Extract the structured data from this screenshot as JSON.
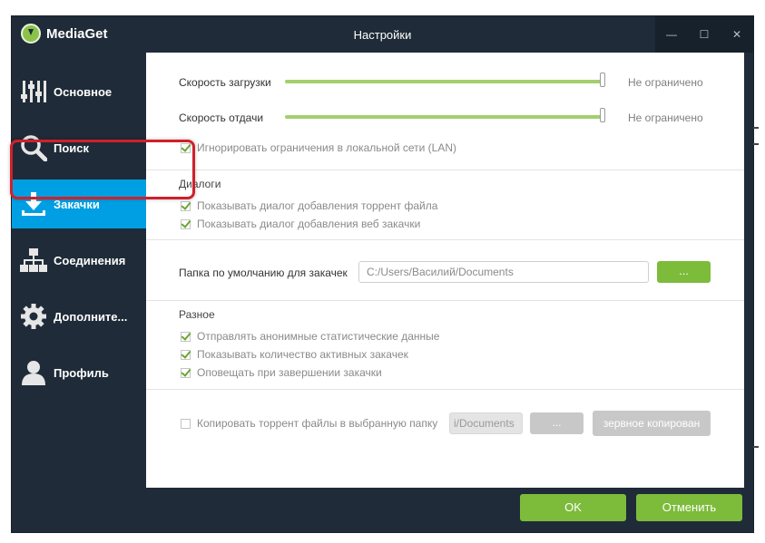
{
  "window": {
    "app_name": "MediaGet",
    "title": "Настройки",
    "controls": {
      "minimize": "—",
      "maximize": "☐",
      "close": "✕"
    }
  },
  "sidebar": {
    "items": [
      {
        "label": "Основное",
        "icon": "sliders-icon"
      },
      {
        "label": "Поиск",
        "icon": "search-icon"
      },
      {
        "label": "Закачки",
        "icon": "download-icon",
        "active": true
      },
      {
        "label": "Соединения",
        "icon": "network-icon"
      },
      {
        "label": "Дополните...",
        "icon": "gear-icon"
      },
      {
        "label": "Профиль",
        "icon": "user-icon"
      }
    ]
  },
  "speed": {
    "download_label": "Скорость загрузки",
    "download_value": "Не ограничено",
    "download_level": 1.0,
    "upload_label": "Скорость отдачи",
    "upload_value": "Не ограничено",
    "upload_level": 1.0,
    "ignore_lan": "Игнорировать ограничения в локальной сети (LAN)"
  },
  "dialogs": {
    "title": "Диалоги",
    "torrent": "Показывать диалог добавления торрент файла",
    "web": "Показывать диалог добавления веб закачки"
  },
  "folder": {
    "label": "Папка по умолчанию для закачек",
    "path": "C:/Users/Василий/Documents",
    "browse": "..."
  },
  "misc": {
    "title": "Разное",
    "stats": "Отправлять анонимные статистические данные",
    "count": "Показывать количество активных закачек",
    "notify": "Оповещать при завершении закачки"
  },
  "copy": {
    "label": "Копировать торрент файлы в выбранную папку",
    "path": "i/Documents",
    "browse": "...",
    "backup": "зервное копирован"
  },
  "footer": {
    "ok": "OK",
    "cancel": "Отменить"
  },
  "colors": {
    "accent": "#009fe3",
    "green": "#7dbb3b",
    "sidebar": "#1f2b38",
    "highlight": "#d0202a"
  }
}
